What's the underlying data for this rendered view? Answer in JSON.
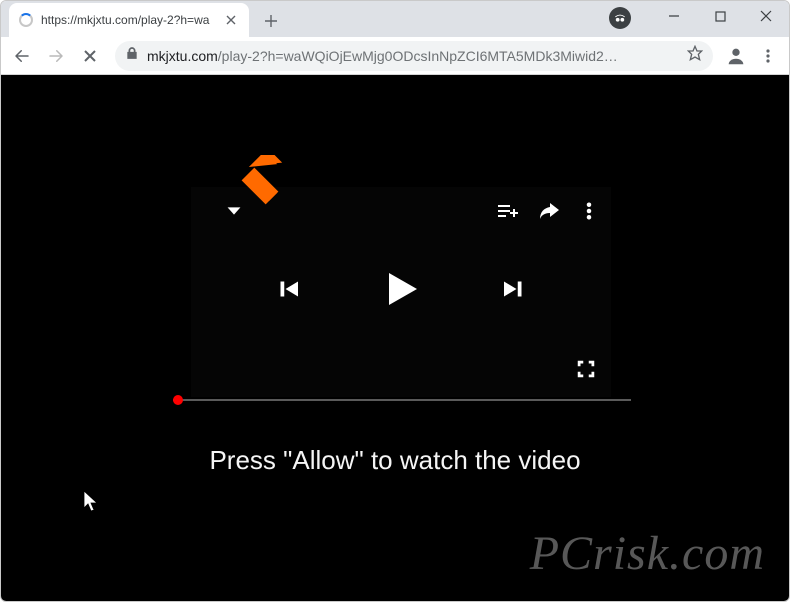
{
  "tab": {
    "title": "https://mkjxtu.com/play-2?h=wa"
  },
  "url": {
    "domain": "mkjxtu.com",
    "path": "/play-2?h=waWQiOjEwMjg0ODcsInNpZCI6MTA5MDk3Miwid2…"
  },
  "page": {
    "message": "Press \"Allow\" to watch the video"
  },
  "watermark": "PCrisk.com"
}
